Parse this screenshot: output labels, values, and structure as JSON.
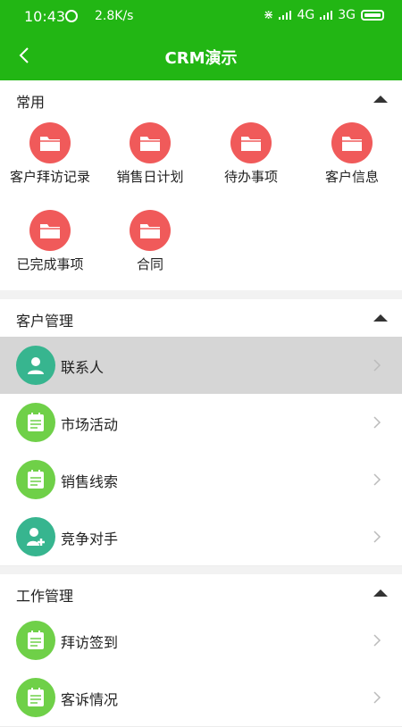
{
  "status": {
    "time": "10:43",
    "speed": "2.8K/s",
    "network1": "4G",
    "network2": "3G"
  },
  "nav": {
    "title": "CRM演示"
  },
  "sections": {
    "common": {
      "title": "常用",
      "items": [
        "客户拜访记录",
        "销售日计划",
        "待办事项",
        "客户信息",
        "已完成事项",
        "合同"
      ]
    },
    "customer": {
      "title": "客户管理",
      "items": [
        "联系人",
        "市场活动",
        "销售线索",
        "竞争对手"
      ]
    },
    "work": {
      "title": "工作管理",
      "items": [
        "拜访签到",
        "客诉情况"
      ]
    }
  },
  "colors": {
    "primary": "#22b614",
    "folder": "#f05a5a",
    "teal": "#37b58f",
    "green": "#6fd048",
    "selected_row": "#d6d6d6"
  },
  "icons": {
    "folder": "folder-icon",
    "contact": "person-icon",
    "list": "checklist-icon",
    "add_person": "add-person-icon"
  }
}
